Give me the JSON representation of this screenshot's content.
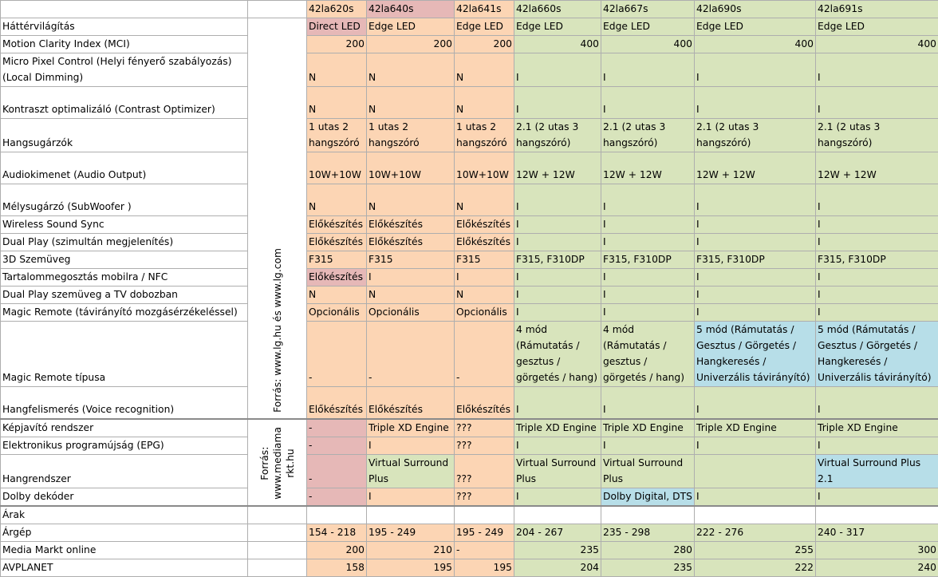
{
  "header": [
    "",
    "",
    "42la620s",
    "42la640s",
    "42la641s",
    "42la660s",
    "42la667s",
    "42la690s",
    "42la691s"
  ],
  "source1": "Forrás: www.lg.hu és www.lg.com",
  "source2": "Forrás:\nwww.mediama\nrkt.hu",
  "colors": {
    "pink": "#e6b8b7",
    "orange": "#fcd5b4",
    "green": "#d8e4bc",
    "blue": "#b7dee8"
  },
  "rows": [
    {
      "label": "Háttérvilágítás",
      "cells": [
        "Direct LED",
        "Edge LED",
        "Edge LED",
        "Edge LED",
        "Edge LED",
        "Edge LED",
        "Edge LED"
      ]
    },
    {
      "label": "Motion Clarity Index (MCI)",
      "cells": [
        "200",
        "200",
        "200",
        "400",
        "400",
        "400",
        "400"
      ]
    },
    {
      "label": "Micro Pixel Control (Helyi fényerő szabályozás) (Local Dimming)",
      "cells": [
        "N",
        "N",
        "N",
        "I",
        "I",
        "I",
        "I"
      ]
    },
    {
      "label": "Kontraszt optimalizáló (Contrast Optimizer)",
      "cells": [
        "N",
        "N",
        "N",
        "I",
        "I",
        "I",
        "I"
      ]
    },
    {
      "label": "Hangsugárzók",
      "cells": [
        "1 utas 2 hangszóró",
        "1 utas 2 hangszóró",
        "1 utas 2 hangszóró",
        "2.1 (2 utas 3 hangszóró)",
        "2.1 (2 utas 3 hangszóró)",
        "2.1 (2 utas 3 hangszóró)",
        "2.1 (2 utas 3 hangszóró)"
      ]
    },
    {
      "label": "Audiokimenet (Audio Output)",
      "cells": [
        "10W+10W",
        "10W+10W",
        "10W+10W",
        "12W + 12W",
        "12W + 12W",
        "12W + 12W",
        "12W + 12W"
      ]
    },
    {
      "label": "Mélysugárzó (SubWoofer )",
      "cells": [
        "N",
        "N",
        "N",
        "I",
        "I",
        "I",
        "I"
      ]
    },
    {
      "label": "Wireless Sound Sync",
      "cells": [
        "Előkészítés",
        "Előkészítés",
        "Előkészítés",
        "I",
        "I",
        "I",
        "I"
      ]
    },
    {
      "label": "Dual Play (szimultán megjelenítés)",
      "cells": [
        "Előkészítés",
        "Előkészítés",
        "Előkészítés",
        "I",
        "I",
        "I",
        "I"
      ]
    },
    {
      "label": "3D Szemüveg",
      "cells": [
        "F315",
        "F315",
        "F315",
        "F315, F310DP",
        "F315, F310DP",
        "F315, F310DP",
        "F315, F310DP"
      ]
    },
    {
      "label": "Tartalommegosztás mobilra / NFC",
      "cells": [
        "Előkészítés",
        "I",
        "I",
        "I",
        "I",
        "I",
        "I"
      ]
    },
    {
      "label": "Dual Play szemüveg a TV dobozban",
      "cells": [
        "N",
        "N",
        "N",
        "I",
        "I",
        "I",
        "I"
      ]
    },
    {
      "label": "Magic Remote (távirányító mozgásérzékeléssel)",
      "cells": [
        "Opcionális",
        "Opcionális",
        "Opcionális",
        "I",
        "I",
        "I",
        "I"
      ]
    },
    {
      "label": "Magic Remote típusa",
      "cells": [
        "-",
        "-",
        "-",
        "4 mód (Rámutatás / gesztus / görgetés / hang)",
        "4 mód (Rámutatás / gesztus / görgetés / hang)",
        "5 mód (Rámutatás / Gesztus / Görgetés / Hangkeresés / Univerzális távirányító)",
        "5 mód (Rámutatás / Gesztus / Görgetés / Hangkeresés / Univerzális távirányító)"
      ]
    },
    {
      "label": "Hangfelismerés (Voice recognition)",
      "cells": [
        "Előkészítés",
        "Előkészítés",
        "Előkészítés",
        "I",
        "I",
        "I",
        "I"
      ]
    },
    {
      "label": "Képjavító rendszer",
      "cells": [
        "-",
        "Triple XD Engine",
        "???",
        "Triple XD Engine",
        "Triple XD Engine",
        "Triple XD Engine",
        "Triple XD Engine"
      ]
    },
    {
      "label": "Elektronikus programújság (EPG)",
      "cells": [
        "-",
        "I",
        "???",
        "I",
        "I",
        "I",
        "I"
      ]
    },
    {
      "label": "Hangrendszer",
      "cells": [
        "-",
        "Virtual Surround Plus",
        "???",
        "Virtual Surround Plus",
        "Virtual Surround Plus",
        "",
        "Virtual Surround Plus 2.1"
      ]
    },
    {
      "label": "Dolby dekóder",
      "cells": [
        "-",
        "I",
        "???",
        "I",
        "Dolby Digital, DTS",
        "I",
        "I"
      ]
    },
    {
      "label": "Árak",
      "cells": [
        "",
        "",
        "",
        "",
        "",
        "",
        ""
      ]
    },
    {
      "label": "Árgép",
      "cells": [
        "154 - 218",
        "195 - 249",
        "195 - 249",
        "204 - 267",
        "235 - 298",
        "222 - 276",
        "240 - 317"
      ]
    },
    {
      "label": "Media Markt online",
      "cells": [
        "200",
        "210",
        "-",
        "235",
        "280",
        "255",
        "300"
      ]
    },
    {
      "label": "AVPLANET",
      "cells": [
        "158",
        "195",
        "195",
        "204",
        "235",
        "222",
        "240"
      ]
    }
  ]
}
